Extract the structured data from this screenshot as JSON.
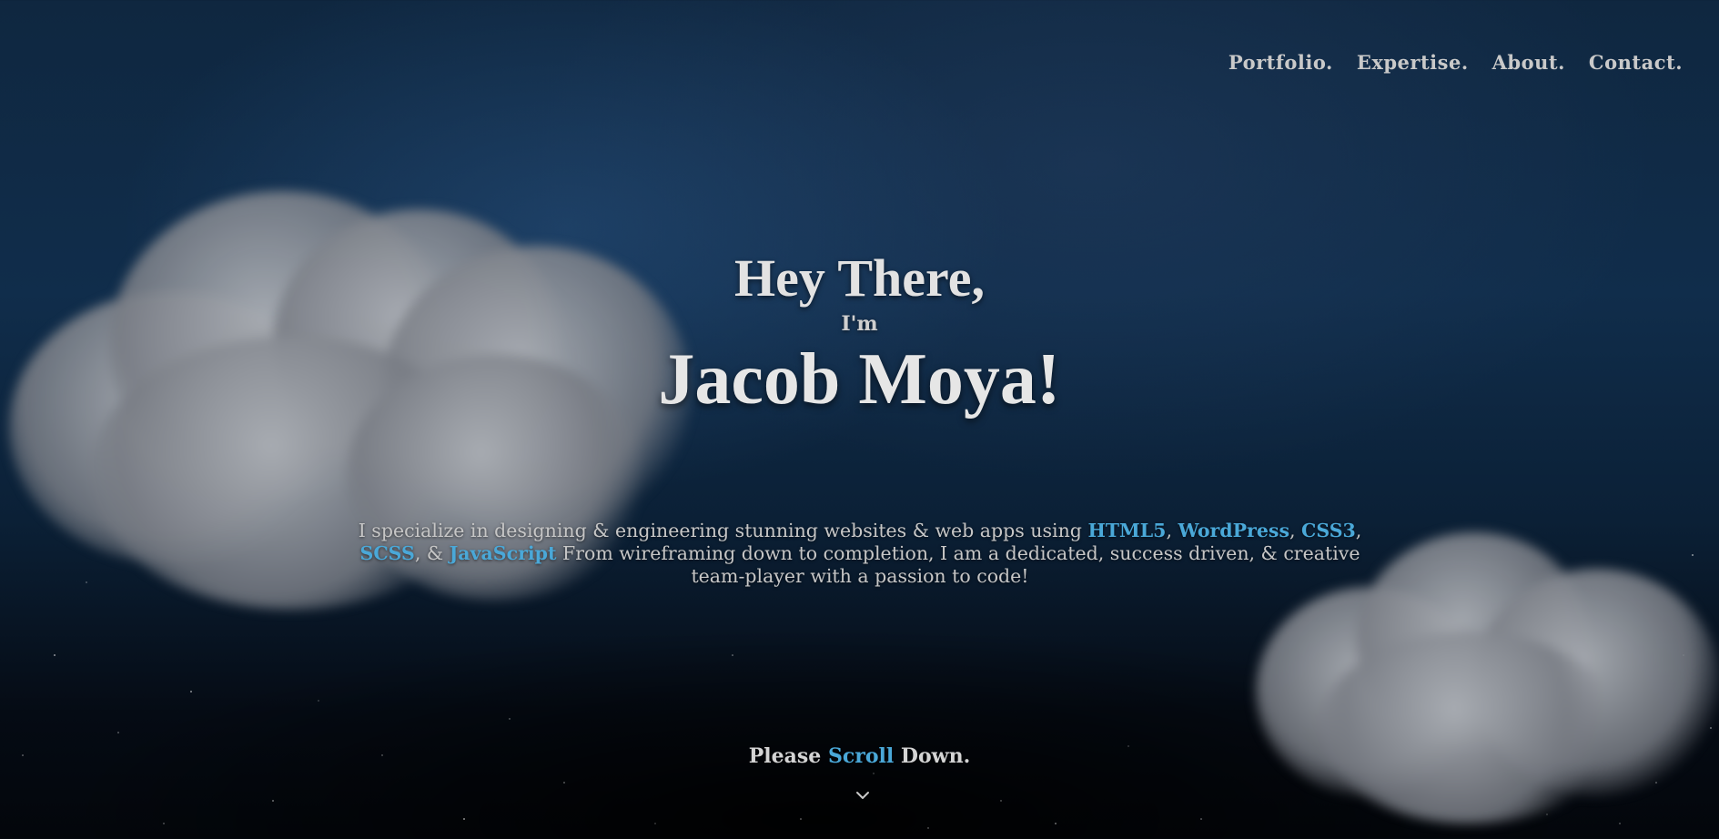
{
  "nav": {
    "items": [
      {
        "label": "Portfolio."
      },
      {
        "label": "Expertise."
      },
      {
        "label": "About."
      },
      {
        "label": "Contact."
      }
    ]
  },
  "hero": {
    "greeting": "Hey There,",
    "im": "I'm",
    "name": "Jacob Moya!"
  },
  "intro": {
    "part1": "I specialize in designing & engineering stunning websites & web apps using ",
    "skill_html5": "HTML5",
    "sep1": ", ",
    "skill_wordpress": "WordPress",
    "sep2": ", ",
    "skill_css3": "CSS3",
    "sep3": ", ",
    "skill_scss": "SCSS",
    "sep4": ", & ",
    "skill_javascript": "JavaScript",
    "part2": " From wireframing down to completion, I am a dedicated, success driven, & creative team-player with a passion to code!"
  },
  "scroll_prompt": {
    "before": "Please ",
    "link": "Scroll",
    "after": " Down."
  },
  "icons": {
    "scroll_down": "chevron-down-icon"
  },
  "colors": {
    "accent": "#4aa8d8",
    "text": "#d8d8d8",
    "background_top": "#0f2740",
    "background_bottom": "#03060b"
  }
}
